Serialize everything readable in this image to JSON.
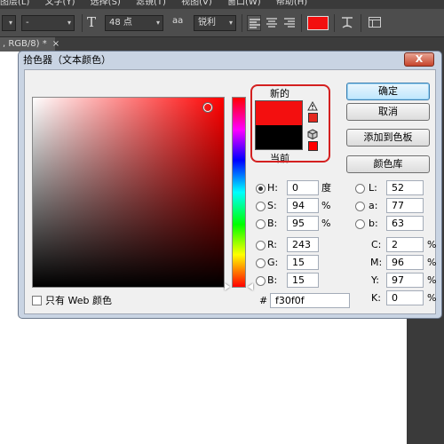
{
  "menubar": {
    "items": [
      "图层(L)",
      "文字(Y)",
      "选择(S)",
      "滤镜(T)",
      "视图(V)",
      "窗口(W)",
      "帮助(H)"
    ]
  },
  "options": {
    "font_style": "-",
    "size_label": "T",
    "font_size": "48 点",
    "aa_icon_label": "aa",
    "antialias": "锐利"
  },
  "document_tab": {
    "title": ", RGB/8) *",
    "close": "×"
  },
  "dialog": {
    "title": "拾色器（文本颜色）",
    "close": "X",
    "new_label": "新的",
    "current_label": "当前",
    "new_color": "#f30f0f",
    "current_color": "#000000",
    "only_web_label": "只有 Web 颜色",
    "buttons": {
      "ok": "确定",
      "cancel": "取消",
      "add_to_swatches": "添加到色板",
      "color_libraries": "颜色库"
    },
    "hsb": [
      {
        "label": "H:",
        "value": "0",
        "unit": "度",
        "selected": true
      },
      {
        "label": "S:",
        "value": "94",
        "unit": "%",
        "selected": false
      },
      {
        "label": "B:",
        "value": "95",
        "unit": "%",
        "selected": false
      }
    ],
    "rgb": [
      {
        "label": "R:",
        "value": "243"
      },
      {
        "label": "G:",
        "value": "15"
      },
      {
        "label": "B:",
        "value": "15"
      }
    ],
    "lab": [
      {
        "label": "L:",
        "value": "52"
      },
      {
        "label": "a:",
        "value": "77"
      },
      {
        "label": "b:",
        "value": "63"
      }
    ],
    "cmyk": [
      {
        "label": "C:",
        "value": "2",
        "unit": "%"
      },
      {
        "label": "M:",
        "value": "96",
        "unit": "%"
      },
      {
        "label": "Y:",
        "value": "97",
        "unit": "%"
      },
      {
        "label": "K:",
        "value": "0",
        "unit": "%"
      }
    ],
    "hex_label": "#",
    "hex_value": "f30f0f"
  },
  "colors": {
    "accent_red": "#d42020",
    "hue_base": "#ff0000"
  }
}
